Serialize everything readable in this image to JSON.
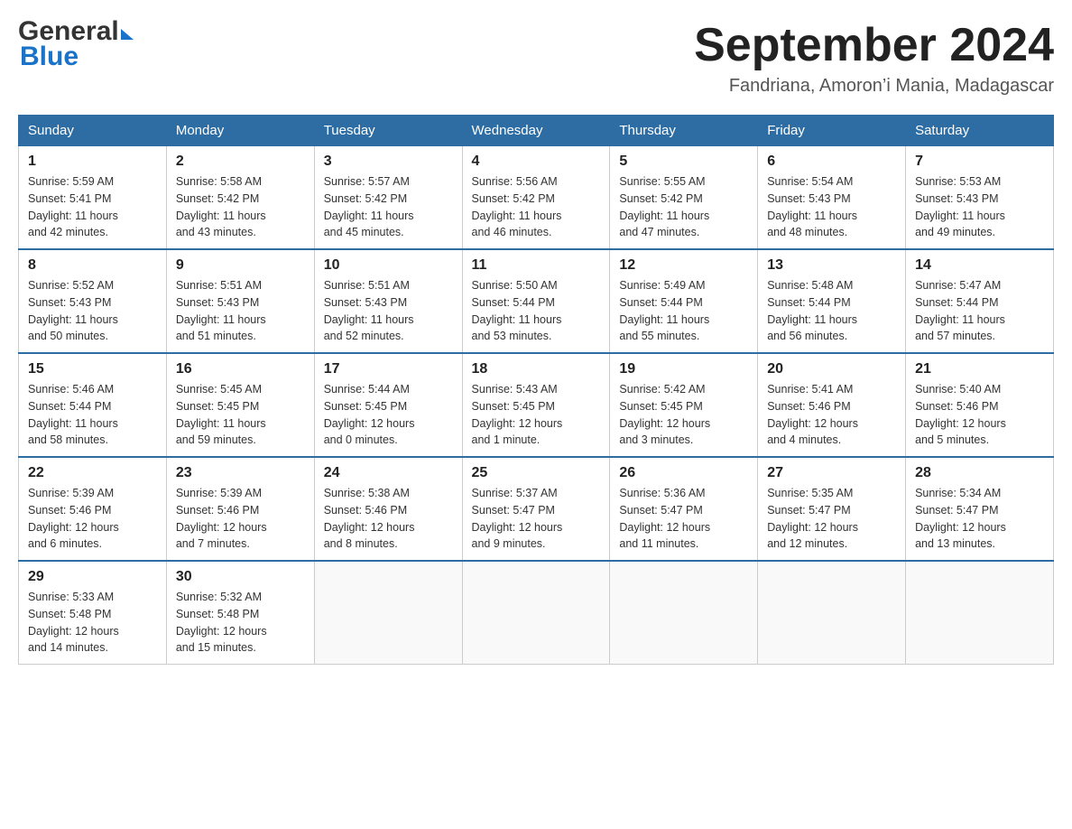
{
  "header": {
    "logo_general": "General",
    "logo_blue": "Blue",
    "month_title": "September 2024",
    "subtitle": "Fandriana, Amoron’i Mania, Madagascar"
  },
  "days_of_week": [
    "Sunday",
    "Monday",
    "Tuesday",
    "Wednesday",
    "Thursday",
    "Friday",
    "Saturday"
  ],
  "weeks": [
    [
      {
        "day": "1",
        "sunrise": "5:59 AM",
        "sunset": "5:41 PM",
        "daylight": "11 hours and 42 minutes."
      },
      {
        "day": "2",
        "sunrise": "5:58 AM",
        "sunset": "5:42 PM",
        "daylight": "11 hours and 43 minutes."
      },
      {
        "day": "3",
        "sunrise": "5:57 AM",
        "sunset": "5:42 PM",
        "daylight": "11 hours and 45 minutes."
      },
      {
        "day": "4",
        "sunrise": "5:56 AM",
        "sunset": "5:42 PM",
        "daylight": "11 hours and 46 minutes."
      },
      {
        "day": "5",
        "sunrise": "5:55 AM",
        "sunset": "5:42 PM",
        "daylight": "11 hours and 47 minutes."
      },
      {
        "day": "6",
        "sunrise": "5:54 AM",
        "sunset": "5:43 PM",
        "daylight": "11 hours and 48 minutes."
      },
      {
        "day": "7",
        "sunrise": "5:53 AM",
        "sunset": "5:43 PM",
        "daylight": "11 hours and 49 minutes."
      }
    ],
    [
      {
        "day": "8",
        "sunrise": "5:52 AM",
        "sunset": "5:43 PM",
        "daylight": "11 hours and 50 minutes."
      },
      {
        "day": "9",
        "sunrise": "5:51 AM",
        "sunset": "5:43 PM",
        "daylight": "11 hours and 51 minutes."
      },
      {
        "day": "10",
        "sunrise": "5:51 AM",
        "sunset": "5:43 PM",
        "daylight": "11 hours and 52 minutes."
      },
      {
        "day": "11",
        "sunrise": "5:50 AM",
        "sunset": "5:44 PM",
        "daylight": "11 hours and 53 minutes."
      },
      {
        "day": "12",
        "sunrise": "5:49 AM",
        "sunset": "5:44 PM",
        "daylight": "11 hours and 55 minutes."
      },
      {
        "day": "13",
        "sunrise": "5:48 AM",
        "sunset": "5:44 PM",
        "daylight": "11 hours and 56 minutes."
      },
      {
        "day": "14",
        "sunrise": "5:47 AM",
        "sunset": "5:44 PM",
        "daylight": "11 hours and 57 minutes."
      }
    ],
    [
      {
        "day": "15",
        "sunrise": "5:46 AM",
        "sunset": "5:44 PM",
        "daylight": "11 hours and 58 minutes."
      },
      {
        "day": "16",
        "sunrise": "5:45 AM",
        "sunset": "5:45 PM",
        "daylight": "11 hours and 59 minutes."
      },
      {
        "day": "17",
        "sunrise": "5:44 AM",
        "sunset": "5:45 PM",
        "daylight": "12 hours and 0 minutes."
      },
      {
        "day": "18",
        "sunrise": "5:43 AM",
        "sunset": "5:45 PM",
        "daylight": "12 hours and 1 minute."
      },
      {
        "day": "19",
        "sunrise": "5:42 AM",
        "sunset": "5:45 PM",
        "daylight": "12 hours and 3 minutes."
      },
      {
        "day": "20",
        "sunrise": "5:41 AM",
        "sunset": "5:46 PM",
        "daylight": "12 hours and 4 minutes."
      },
      {
        "day": "21",
        "sunrise": "5:40 AM",
        "sunset": "5:46 PM",
        "daylight": "12 hours and 5 minutes."
      }
    ],
    [
      {
        "day": "22",
        "sunrise": "5:39 AM",
        "sunset": "5:46 PM",
        "daylight": "12 hours and 6 minutes."
      },
      {
        "day": "23",
        "sunrise": "5:39 AM",
        "sunset": "5:46 PM",
        "daylight": "12 hours and 7 minutes."
      },
      {
        "day": "24",
        "sunrise": "5:38 AM",
        "sunset": "5:46 PM",
        "daylight": "12 hours and 8 minutes."
      },
      {
        "day": "25",
        "sunrise": "5:37 AM",
        "sunset": "5:47 PM",
        "daylight": "12 hours and 9 minutes."
      },
      {
        "day": "26",
        "sunrise": "5:36 AM",
        "sunset": "5:47 PM",
        "daylight": "12 hours and 11 minutes."
      },
      {
        "day": "27",
        "sunrise": "5:35 AM",
        "sunset": "5:47 PM",
        "daylight": "12 hours and 12 minutes."
      },
      {
        "day": "28",
        "sunrise": "5:34 AM",
        "sunset": "5:47 PM",
        "daylight": "12 hours and 13 minutes."
      }
    ],
    [
      {
        "day": "29",
        "sunrise": "5:33 AM",
        "sunset": "5:48 PM",
        "daylight": "12 hours and 14 minutes."
      },
      {
        "day": "30",
        "sunrise": "5:32 AM",
        "sunset": "5:48 PM",
        "daylight": "12 hours and 15 minutes."
      },
      null,
      null,
      null,
      null,
      null
    ]
  ],
  "labels": {
    "sunrise": "Sunrise:",
    "sunset": "Sunset:",
    "daylight": "Daylight:"
  }
}
